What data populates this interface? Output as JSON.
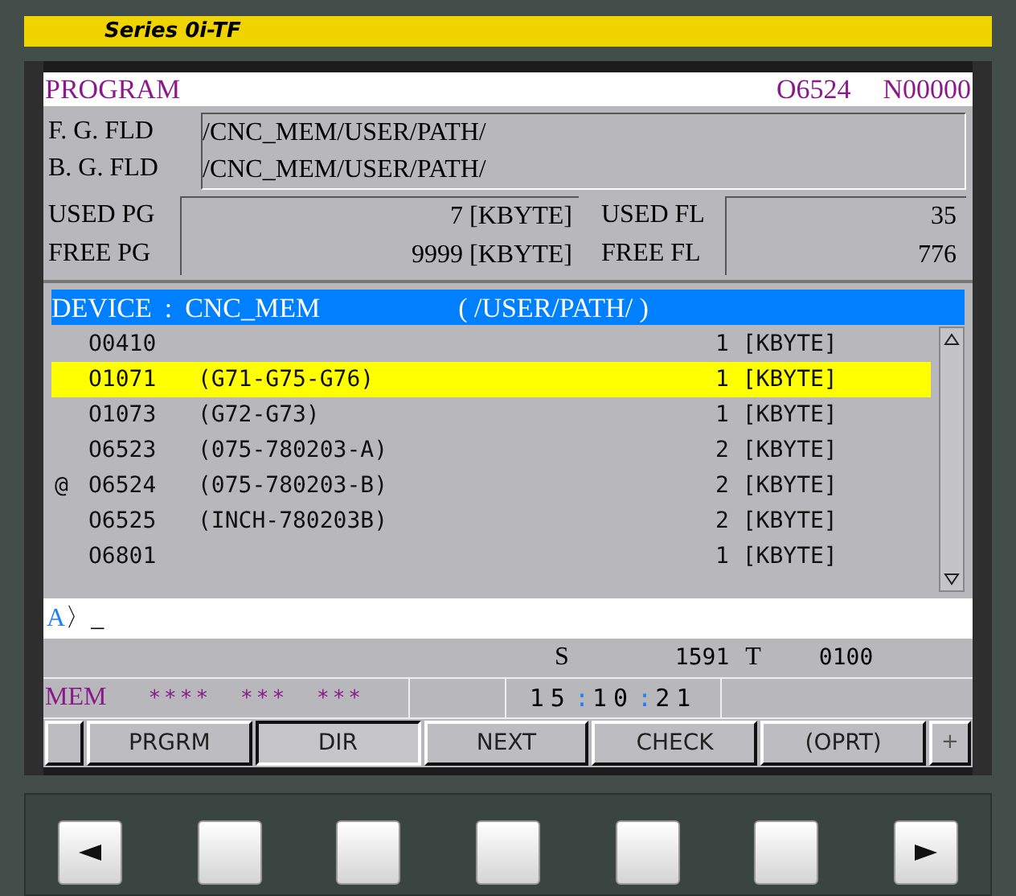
{
  "model": "Series 0i-TF",
  "header": {
    "title": "PROGRAM",
    "program": "O6524",
    "sequence": "N00000"
  },
  "folders": [
    {
      "label": "F. G. FLD",
      "path": "/CNC_MEM/USER/PATH/"
    },
    {
      "label": "B. G. FLD",
      "path": "/CNC_MEM/USER/PATH/"
    }
  ],
  "usage": {
    "used_pg_label": "USED PG",
    "used_pg": "7 [KBYTE]",
    "free_pg_label": "FREE PG",
    "free_pg": "9999 [KBYTE]",
    "used_fl_label": "USED FL",
    "used_fl": "35",
    "free_fl_label": "FREE FL",
    "free_fl": "776"
  },
  "device": {
    "label": "DEVICE",
    "separator": ":",
    "name": "CNC_MEM",
    "path": "( /USER/PATH/ )"
  },
  "programs": [
    {
      "number": "O0410",
      "size": "1 [KBYTE]",
      "selected": false,
      "current": false
    },
    {
      "number": "O1071",
      "comment": "(G71-G75-G76)",
      "size": "1 [KBYTE]",
      "selected": true,
      "current": false
    },
    {
      "number": "O1073",
      "comment": "(G72-G73)",
      "size": "1 [KBYTE]",
      "selected": false,
      "current": false
    },
    {
      "number": "O6523",
      "comment": "(075-780203-A)",
      "size": "2 [KBYTE]",
      "selected": false,
      "current": false
    },
    {
      "number": "O6524",
      "comment": "(075-780203-B)",
      "size": "2 [KBYTE]",
      "selected": false,
      "current": true
    },
    {
      "number": "O6525",
      "comment": "(INCH-780203B)",
      "size": "2 [KBYTE]",
      "selected": false,
      "current": false
    },
    {
      "number": "O6801",
      "size": "1 [KBYTE]",
      "selected": false,
      "current": false
    }
  ],
  "current_marker": "@",
  "input": {
    "prompt": "A",
    "caret": "〉",
    "cursor": "_"
  },
  "spindle": {
    "s_label": "S",
    "s_value": "1591",
    "t_label": "T",
    "t_value": "0100"
  },
  "status": {
    "mode": "MEM",
    "fields": [
      "****",
      "***",
      "***"
    ],
    "time": [
      "15",
      "10",
      "21"
    ],
    "time_separator": ":"
  },
  "softkeys": [
    {
      "selected": false
    },
    {
      "label": "PRGRM",
      "selected": false
    },
    {
      "label": "DIR",
      "selected": true
    },
    {
      "label": "NEXT",
      "selected": false
    },
    {
      "label": "CHECK",
      "selected": false
    },
    {
      "label": "(OPRT)",
      "selected": false
    },
    {
      "label": "+",
      "selected": false
    }
  ],
  "keys": [
    {
      "kind": "left"
    },
    {
      "kind": "blank"
    },
    {
      "kind": "blank"
    },
    {
      "kind": "blank"
    },
    {
      "kind": "blank"
    },
    {
      "kind": "blank"
    },
    {
      "kind": "right"
    }
  ]
}
